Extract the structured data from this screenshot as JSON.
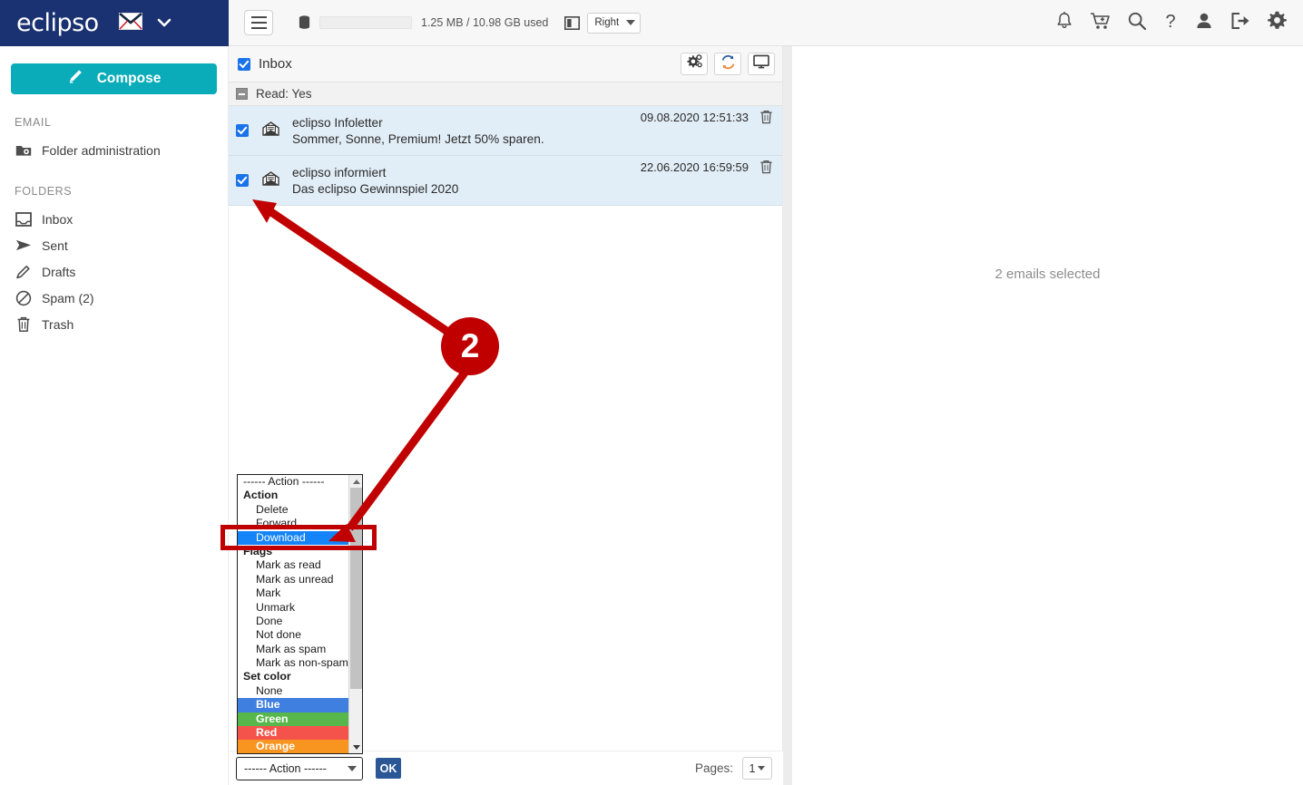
{
  "brand": {
    "name": "eclipso",
    "mail_icon": "envelope-icon",
    "caret_icon": "chevron-down-icon"
  },
  "topbar": {
    "menu_icon": "hamburger-menu-icon",
    "quota_icon": "database-icon",
    "quota_text": "1.25 MB / 10.98 GB used",
    "layout_icon": "split-layout-icon",
    "layout_value": "Right",
    "icons": [
      "bell-icon",
      "cart-plus-icon",
      "search-icon",
      "help-icon",
      "user-icon",
      "logout-icon",
      "gear-icon"
    ]
  },
  "sidebar": {
    "compose_label": "Compose",
    "compose_icon": "pencil-icon",
    "compose_color": "#0aacb9",
    "sections": [
      {
        "title": "EMAIL",
        "items": [
          {
            "label": "Folder administration",
            "icon": "folder-settings-icon"
          }
        ]
      },
      {
        "title": "FOLDERS",
        "items": [
          {
            "label": "Inbox",
            "icon": "inbox-icon"
          },
          {
            "label": "Sent",
            "icon": "send-icon"
          },
          {
            "label": "Drafts",
            "icon": "pencil-icon"
          },
          {
            "label": "Spam (2)",
            "icon": "no-entry-icon"
          },
          {
            "label": "Trash",
            "icon": "trash-icon"
          }
        ]
      }
    ]
  },
  "maillist": {
    "header": {
      "title": "Inbox",
      "select_all_checked": true,
      "buttons": [
        {
          "name": "list-settings-button",
          "icon": "gears-icon"
        },
        {
          "name": "refresh-button",
          "icon": "refresh-icon"
        },
        {
          "name": "display-button",
          "icon": "monitor-icon"
        }
      ]
    },
    "group": {
      "label": "Read: Yes",
      "collapse_icon": "minus-box-icon"
    },
    "rows": [
      {
        "checked": true,
        "icon": "open-envelope-icon",
        "from": "eclipso Infoletter",
        "subject": "Sommer, Sonne, Premium! Jetzt 50% sparen.",
        "date": "09.08.2020 12:51:33",
        "delete_icon": "trash-icon"
      },
      {
        "checked": true,
        "icon": "open-envelope-icon",
        "from": "eclipso informiert",
        "subject": "Das eclipso Gewinnspiel 2020",
        "date": "22.06.2020 16:59:59",
        "delete_icon": "trash-icon"
      }
    ]
  },
  "bottombar": {
    "action_value": "------ Action ------",
    "ok_label": "OK",
    "pages_label": "Pages:",
    "pages_value": "1"
  },
  "listbox": {
    "selected": "Download",
    "options": [
      {
        "label": "------ Action ------",
        "type": "plain"
      },
      {
        "label": "Action",
        "type": "header"
      },
      {
        "label": "Delete",
        "type": "option"
      },
      {
        "label": "Forward",
        "type": "option"
      },
      {
        "label": "Download",
        "type": "selected"
      },
      {
        "label": "Flags",
        "type": "header"
      },
      {
        "label": "Mark as read",
        "type": "option"
      },
      {
        "label": "Mark as unread",
        "type": "option"
      },
      {
        "label": "Mark",
        "type": "option"
      },
      {
        "label": "Unmark",
        "type": "option"
      },
      {
        "label": "Done",
        "type": "option"
      },
      {
        "label": "Not done",
        "type": "option"
      },
      {
        "label": "Mark as spam",
        "type": "option"
      },
      {
        "label": "Mark as non-spam",
        "type": "option"
      },
      {
        "label": "Set color",
        "type": "header"
      },
      {
        "label": "None",
        "type": "option"
      },
      {
        "label": "Blue",
        "type": "color-blue"
      },
      {
        "label": "Green",
        "type": "color-green"
      },
      {
        "label": "Red",
        "type": "color-red"
      },
      {
        "label": "Orange",
        "type": "color-orange"
      }
    ]
  },
  "readpane": {
    "empty_message": "2 emails selected"
  },
  "annotation": {
    "badge_number": "2",
    "color": "#c00000"
  }
}
